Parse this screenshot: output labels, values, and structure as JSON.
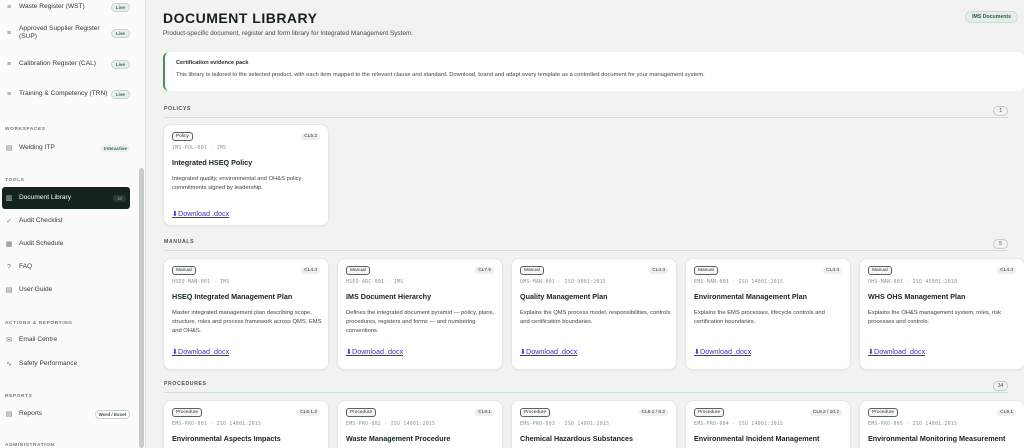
{
  "sidebar": {
    "top_items": [
      {
        "label": "Waste Register (WST)",
        "badge": "Live"
      },
      {
        "label": "Approved Supplier Register (SUP)",
        "badge": "Live"
      },
      {
        "label": "Calibration Register (CAL)",
        "badge": "Live"
      },
      {
        "label": "Training & Competency (TRN)",
        "badge": "Live"
      }
    ],
    "workspaces_heading": "WORKSPACES",
    "welding": {
      "label": "Welding ITP",
      "badge": "Interactive"
    },
    "tools_heading": "TOOLS",
    "tools": [
      {
        "label": "Document Library",
        "badge": "10"
      },
      {
        "label": "Audit Checklist"
      },
      {
        "label": "Audit Schedule"
      },
      {
        "label": "FAQ"
      },
      {
        "label": "User Guide"
      }
    ],
    "actions_heading": "ACTIONS & REPORTING",
    "actions": [
      {
        "label": "Email Centre"
      },
      {
        "label": "Safety Performance"
      }
    ],
    "reports_heading": "REPORTS",
    "reports": {
      "label": "Reports",
      "badge": "Word / Excel"
    },
    "admin_heading": "ADMINISTRATION"
  },
  "header": {
    "title": "DOCUMENT LIBRARY",
    "subtitle": "Product-specific document, register and form library for Integrated Management System.",
    "badge": "IMS Documents"
  },
  "callout": {
    "heading": "Certification evidence pack",
    "text": "This library is tailored to the selected product, with each item mapped to the relevant clause and standard. Download, brand and adapt every template as a controlled document for your management system."
  },
  "sections": {
    "policies": {
      "label": "POLICYS",
      "count": "1"
    },
    "manuals": {
      "label": "MANUALS",
      "count": "5"
    },
    "procedures": {
      "label": "PROCEDURES",
      "count": "34"
    }
  },
  "download_label": "Download .docx",
  "policies": [
    {
      "tag": "Policy",
      "cls": "CL5.2",
      "code": "IMS-POL-001 · IMS",
      "name": "Integrated HSEQ Policy",
      "desc": "Integrated quality, environmental and OH&S policy commitments signed by leadership."
    }
  ],
  "manuals": [
    {
      "tag": "Manual",
      "cls": "CL4.4",
      "code": "HSEQ-MAN-001 · IMS",
      "name": "HSEQ Integrated Management Plan",
      "desc": "Master integrated management plan describing scope, structure, roles and process framework across QMS, EMS and OH&S."
    },
    {
      "tag": "Manual",
      "cls": "CL7.5",
      "code": "HSEQ-ARC-001 · IMS",
      "name": "IMS Document Hierarchy",
      "desc": "Defines the integrated document pyramid — policy, plans, procedures, registers and forms — and numbering conventions."
    },
    {
      "tag": "Manual",
      "cls": "CL4.4",
      "code": "QMS-MAN-001 · ISO 9001:2015",
      "name": "Quality Management Plan",
      "desc": "Explains the QMS process model, responsibilities, controls and certification boundaries."
    },
    {
      "tag": "Manual",
      "cls": "CL4.4",
      "code": "EMS-MAN-001 · ISO 14001:2015",
      "name": "Environmental Management Plan",
      "desc": "Explains the EMS processes, lifecycle controls and certification boundaries."
    },
    {
      "tag": "Manual",
      "cls": "CL4.4",
      "code": "OHS-MAN-001 · ISO 45001:2018",
      "name": "WHS OHS Management Plan",
      "desc": "Explains the OH&S management system, roles, risk processes and controls."
    }
  ],
  "procedures": [
    {
      "tag": "Procedure",
      "cls": "CL6.1.2",
      "code": "EMS-PRO-001 · ISO 14001:2015",
      "name": "Environmental Aspects Impacts"
    },
    {
      "tag": "Procedure",
      "cls": "CL8.1",
      "code": "EMS-PRO-002 · ISO 14001:2015",
      "name": "Waste Management Procedure"
    },
    {
      "tag": "Procedure",
      "cls": "CL8.1 / 8.2",
      "code": "EMS-PRO-003 · ISO 14001:2015",
      "name": "Chemical Hazardous Substances"
    },
    {
      "tag": "Procedure",
      "cls": "CL8.2 / 10.2",
      "code": "EMS-PRO-004 · ISO 14001:2015",
      "name": "Environmental Incident Management"
    },
    {
      "tag": "Procedure",
      "cls": "CL9.1",
      "code": "EMS-PRO-005 · ISO 14001:2015",
      "name": "Environmental Monitoring Measurement"
    }
  ]
}
